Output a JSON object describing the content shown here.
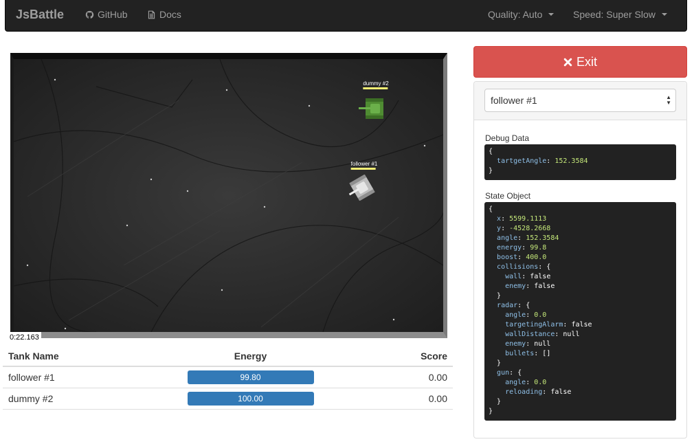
{
  "navbar": {
    "brand": "JsBattle",
    "github_label": "GitHub",
    "docs_label": "Docs",
    "quality_label": "Quality: Auto",
    "speed_label": "Speed: Super Slow"
  },
  "arena": {
    "timer": "0:22.163",
    "tanks": [
      {
        "name": "dummy #2",
        "color": "#5a9a3a"
      },
      {
        "name": "follower #1",
        "color": "#d8d8d8"
      }
    ]
  },
  "score_table": {
    "headers": [
      "Tank Name",
      "Energy",
      "Score"
    ],
    "rows": [
      {
        "name": "follower #1",
        "energy": "99.80",
        "energy_fraction": 0.998,
        "score": "0.00"
      },
      {
        "name": "dummy #2",
        "energy": "100.00",
        "energy_fraction": 1.0,
        "score": "0.00"
      }
    ]
  },
  "sidebar": {
    "exit_label": "Exit",
    "selected_tank": "follower #1",
    "debug_label": "Debug Data",
    "state_label": "State Object",
    "debug_data": {
      "tartgetAngle": "152.3584"
    },
    "state": {
      "x": "5599.1113",
      "y": "-4528.2668",
      "angle": "152.3584",
      "energy": "99.8",
      "boost": "400.0",
      "collisions": {
        "wall": "false",
        "enemy": "false"
      },
      "radar": {
        "angle": "0.0",
        "targetingAlarm": "false",
        "wallDistance": "null",
        "enemy": "null",
        "bullets": "[]"
      },
      "gun": {
        "angle": "0.0",
        "reloading": "false"
      }
    }
  },
  "colors": {
    "navbar_bg": "#222222",
    "exit_btn": "#d9534f",
    "energy_bar": "#337ab7",
    "tank_label_bar": "#f2ed74"
  }
}
